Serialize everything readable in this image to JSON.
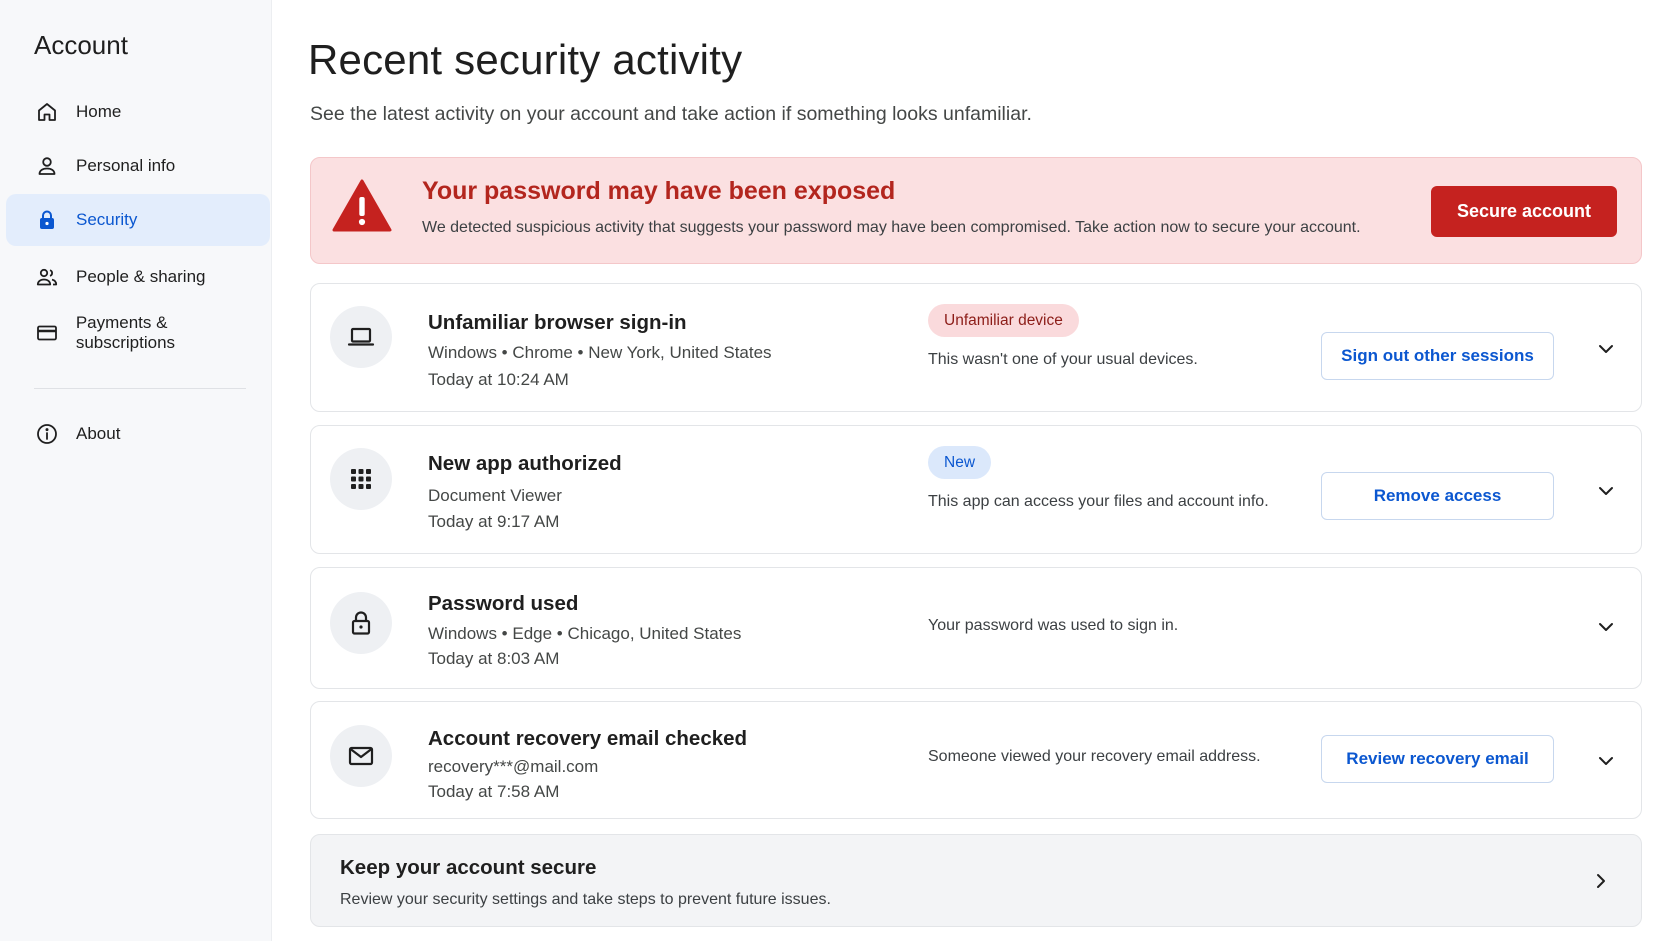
{
  "sidebar": {
    "title": "Account",
    "items": [
      {
        "label": "Home",
        "icon": "home-icon"
      },
      {
        "label": "Personal info",
        "icon": "person-icon"
      },
      {
        "label": "Security",
        "icon": "lock-icon",
        "active": true
      },
      {
        "label": "People & sharing",
        "icon": "people-icon"
      },
      {
        "label": "Payments & subscriptions",
        "icon": "credit-card-icon"
      },
      {
        "label": "About",
        "icon": "info-icon"
      }
    ]
  },
  "main": {
    "title": "Recent security activity",
    "subtitle": "See the latest activity on your account and take action if something looks unfamiliar.",
    "alert": {
      "icon": "warning-icon",
      "title": "Your password may have been exposed",
      "text": "We detected suspicious activity that suggests your password may have been compromised. Take action now to secure your account.",
      "button": "Secure account"
    },
    "activities": [
      {
        "icon": "laptop-icon",
        "title": "Unfamiliar browser sign-in",
        "detail": "Windows • Chrome • New York, United States",
        "time": "Today at 10:24 AM",
        "badge": "Unfamiliar device",
        "description": "This wasn't one of your usual devices.",
        "button": "Sign out other sessions"
      },
      {
        "icon": "apps-grid-icon",
        "title": "New app authorized",
        "detail": "Document Viewer",
        "time": "Today at 9:17 AM",
        "badge": "New",
        "description": "This app can access your files and account info.",
        "button": "Remove access"
      },
      {
        "icon": "padlock-icon",
        "title": "Password used",
        "detail": "Windows • Edge • Chicago, United States",
        "time": "Today at 8:03 AM",
        "description": "Your password was used to sign in."
      },
      {
        "icon": "mail-icon",
        "title": "Account recovery email checked",
        "detail": "recovery***@mail.com",
        "time": "Today at 7:58 AM",
        "description": "Someone viewed your recovery email address.",
        "button": "Review recovery email"
      }
    ],
    "footer": {
      "title": "Keep your account secure",
      "text": "Review your security settings and take steps to prevent future issues."
    }
  },
  "colors": {
    "accent": "#0b57d0",
    "danger": "#c5221f",
    "alert_bg": "#fbe0e1",
    "active_nav_bg": "#e3edfc"
  }
}
